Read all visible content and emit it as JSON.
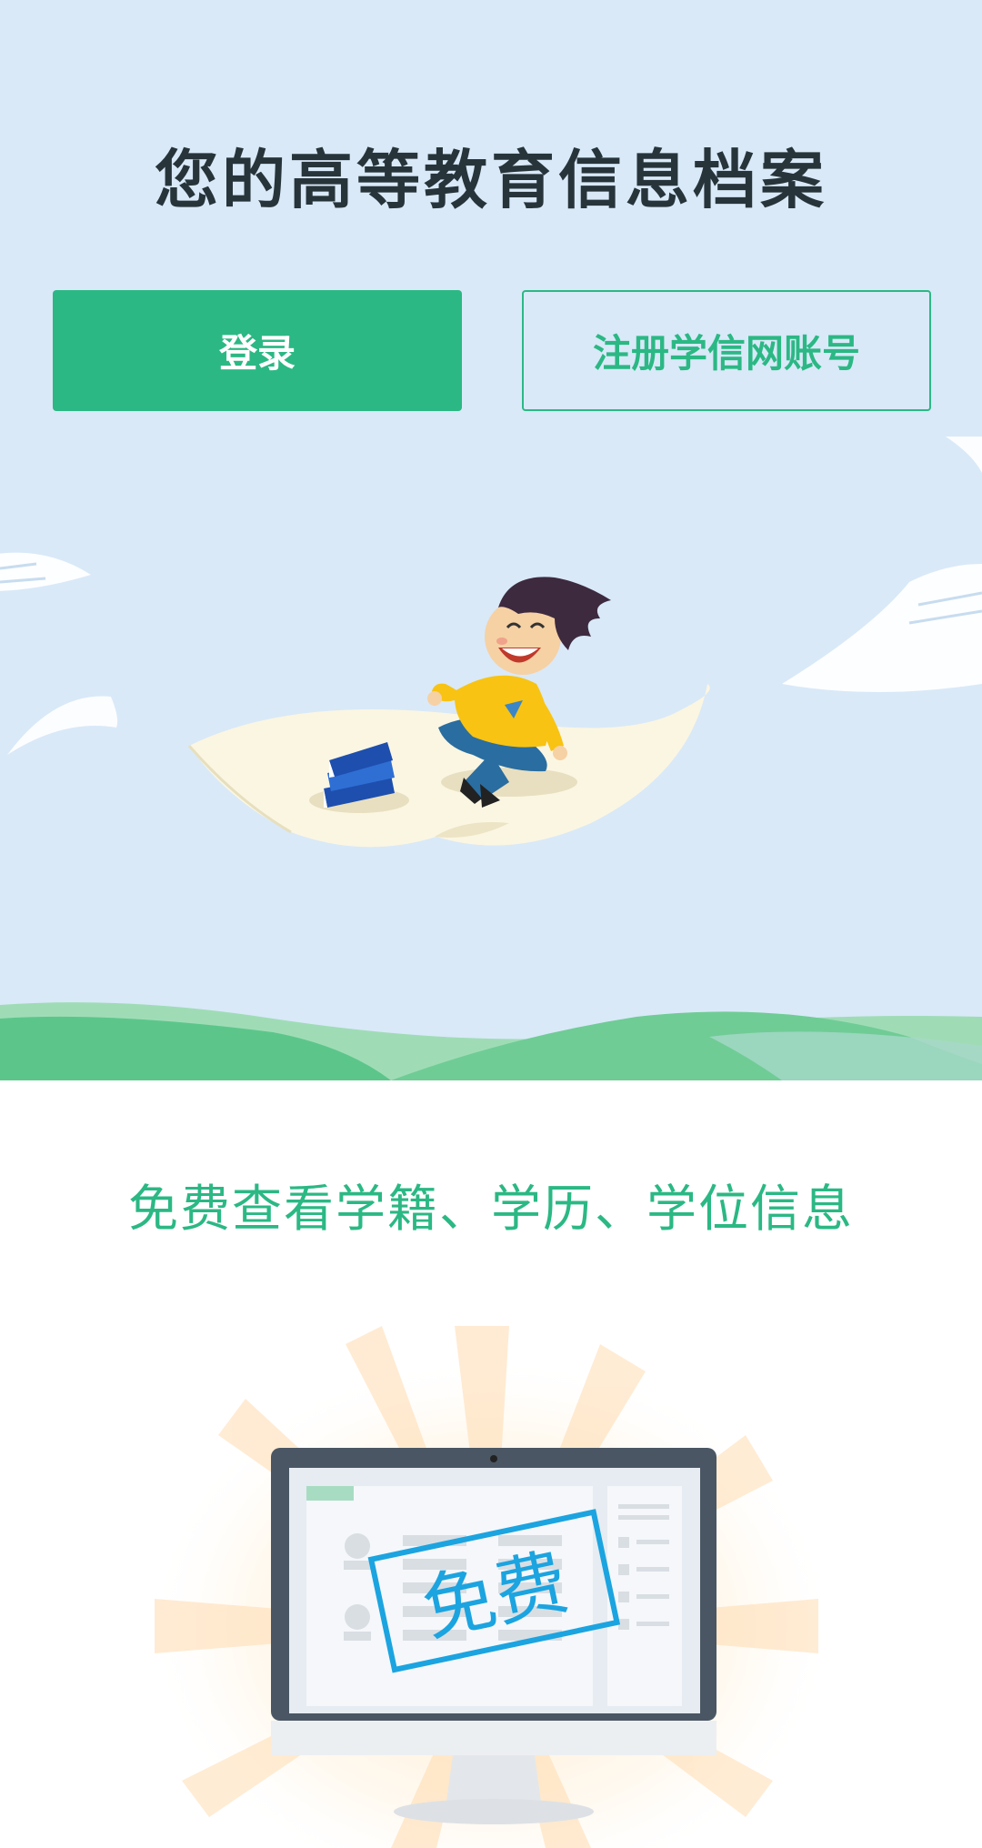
{
  "hero": {
    "title": "您的高等教育信息档案",
    "login_label": "登录",
    "register_label": "注册学信网账号"
  },
  "free_section": {
    "title": "免费查看学籍、学历、学位信息",
    "stamp_text": "免费"
  },
  "colors": {
    "accent": "#2bb884",
    "hero_background": "#d9e9f8",
    "title_text": "#27343a",
    "stamp_blue": "#1ba4e0"
  },
  "icons": {
    "hero_art": "student-on-flying-paper-illustration",
    "monitor_art": "monitor-free-stamp-illustration"
  }
}
